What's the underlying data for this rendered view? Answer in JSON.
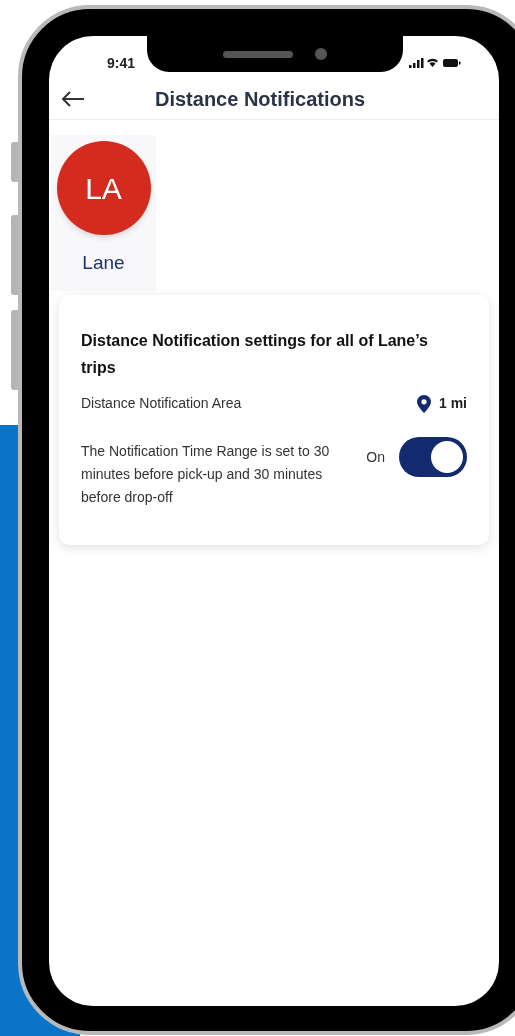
{
  "status_bar": {
    "time": "9:41"
  },
  "header": {
    "title": "Distance Notifications"
  },
  "profile": {
    "initials": "LA",
    "name": "Lane",
    "color": "#d52b1e"
  },
  "card": {
    "title": "Distance Notification settings for all of Lane’s trips",
    "rows": [
      {
        "kind": "value",
        "label": "Distance Notification Area",
        "value": "1 mi"
      },
      {
        "kind": "toggle",
        "label": "The Notification Time Range is set to 30 minutes before pick-up and 30 minutes before drop-off",
        "state_label": "On",
        "on": true
      }
    ]
  }
}
